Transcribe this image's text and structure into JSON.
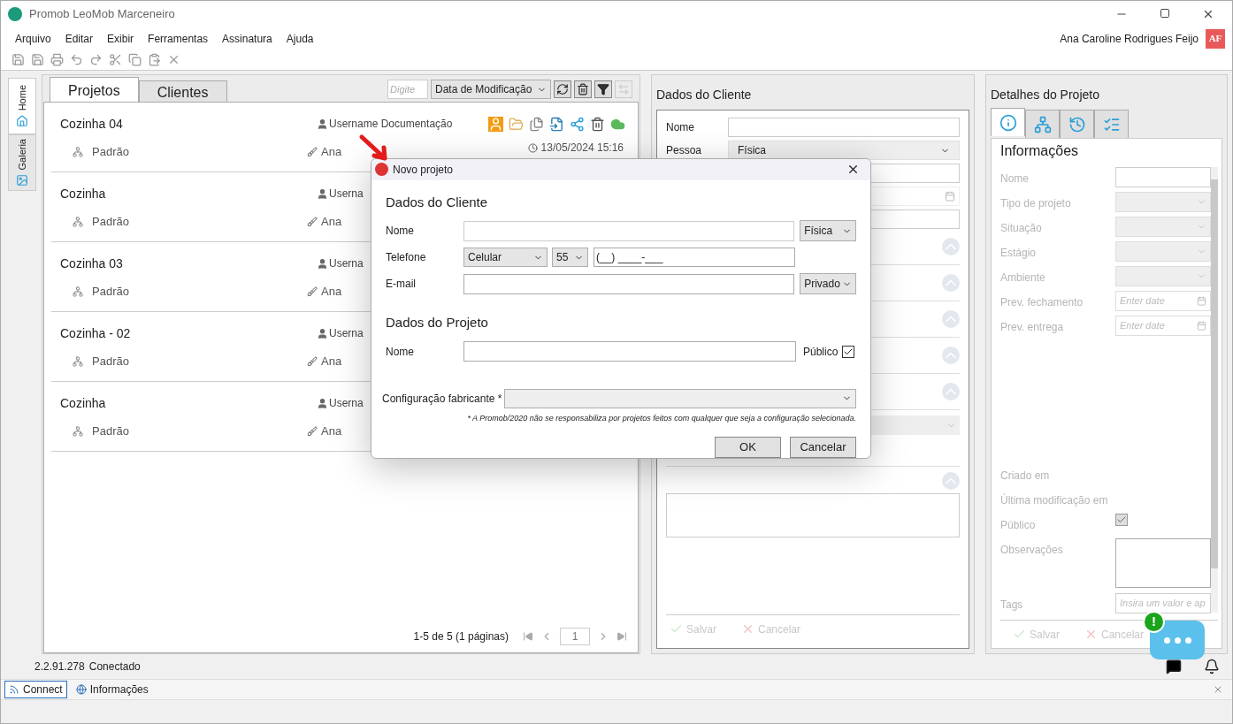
{
  "window": {
    "title": "Promob LeoMob Marceneiro"
  },
  "menu": [
    "Arquivo",
    "Editar",
    "Exibir",
    "Ferramentas",
    "Assinatura",
    "Ajuda"
  ],
  "user": {
    "name": "Ana Caroline Rodrigues Feijo",
    "initials": "AF"
  },
  "side_tabs": [
    {
      "label": "Home",
      "selected": true
    },
    {
      "label": "Galeria",
      "selected": false
    }
  ],
  "projects_panel": {
    "tabs": [
      {
        "label": "Projetos",
        "selected": true
      },
      {
        "label": "Clientes",
        "selected": false
      }
    ],
    "search": {
      "placeholder": "Digite"
    },
    "sort": "Data de Modificação",
    "projects": [
      {
        "name": "Cozinha 04",
        "owner": "Username Documentação",
        "config": "Padrão",
        "author": "Ana",
        "date": "13/05/2024 15:16",
        "actions": true
      },
      {
        "name": "Cozinha",
        "owner": "Userna",
        "config": "Padrão",
        "author": "Ana"
      },
      {
        "name": "Cozinha 03",
        "owner": "Userna",
        "config": "Padrão",
        "author": "Ana"
      },
      {
        "name": "Cozinha - 02",
        "owner": "Userna",
        "config": "Padrão",
        "author": "Ana"
      },
      {
        "name": "Cozinha",
        "owner": "Userna",
        "config": "Padrão",
        "author": "Ana"
      }
    ],
    "pagination": {
      "summary": "1-5 de 5 (1 páginas)",
      "page": "1"
    }
  },
  "client_panel": {
    "title": "Dados do Cliente",
    "fields": [
      {
        "label": "Nome",
        "kind": "text"
      },
      {
        "label": "Pessoa",
        "kind": "select",
        "value": "Física"
      }
    ],
    "buttons": [
      {
        "label": "Salvar",
        "disabled": true
      },
      {
        "label": "Cancelar",
        "disabled": true
      }
    ]
  },
  "details_panel": {
    "title": "Detalhes do Projeto",
    "disabled": true,
    "tabs": [
      {
        "kind": "info",
        "selected": true
      },
      {
        "kind": "tree",
        "selected": false
      },
      {
        "kind": "history",
        "selected": false
      },
      {
        "kind": "checklist",
        "selected": false
      }
    ],
    "heading": "Informações",
    "fields": [
      {
        "label": "Nome",
        "kind": "text"
      },
      {
        "label": "Tipo de projeto",
        "kind": "select"
      },
      {
        "label": "Situação",
        "kind": "select"
      },
      {
        "label": "Estágio",
        "kind": "select"
      },
      {
        "label": "Ambiente",
        "kind": "select"
      },
      {
        "label": "Prev. fechamento",
        "kind": "date",
        "placeholder": "Enter date"
      },
      {
        "label": "Prev. entrega",
        "kind": "date",
        "placeholder": "Enter date"
      },
      {
        "label": "Criado em",
        "kind": "info"
      },
      {
        "label": "Última modificação em",
        "kind": "info"
      },
      {
        "label": "Público",
        "kind": "checkbox",
        "checked": true
      },
      {
        "label": "Observações",
        "kind": "textarea"
      },
      {
        "label": "Tags",
        "kind": "text",
        "placeholder": "Insira um valor e ap"
      }
    ],
    "buttons": [
      {
        "label": "Salvar",
        "disabled": true
      },
      {
        "label": "Cancelar",
        "disabled": true
      }
    ]
  },
  "dialog": {
    "title": "Novo projeto",
    "client_heading": "Dados do Cliente",
    "name_label": "Nome",
    "person_type": "Física",
    "phone_label": "Telefone",
    "phone_type": "Celular",
    "country_code": "55",
    "phone_mask": "(__) ____-___",
    "email_label": "E-mail",
    "email_privacy": "Privado",
    "project_heading": "Dados do Projeto",
    "project_name_label": "Nome",
    "public_label": "Público",
    "public": true,
    "config_label": "Configuração fabricante *",
    "note": "* A Promob/2020 não se responsabiliza por projetos feitos com qualquer que seja a configuração selecionada.",
    "buttons": [
      "OK",
      "Cancelar"
    ]
  },
  "status_bar": {
    "version": "2.2.91.278",
    "state": "Conectado",
    "chat_badge": "!"
  },
  "bottom_tabs": [
    {
      "label": "Connect",
      "selected": true
    },
    {
      "label": "Informações",
      "selected": false
    }
  ]
}
